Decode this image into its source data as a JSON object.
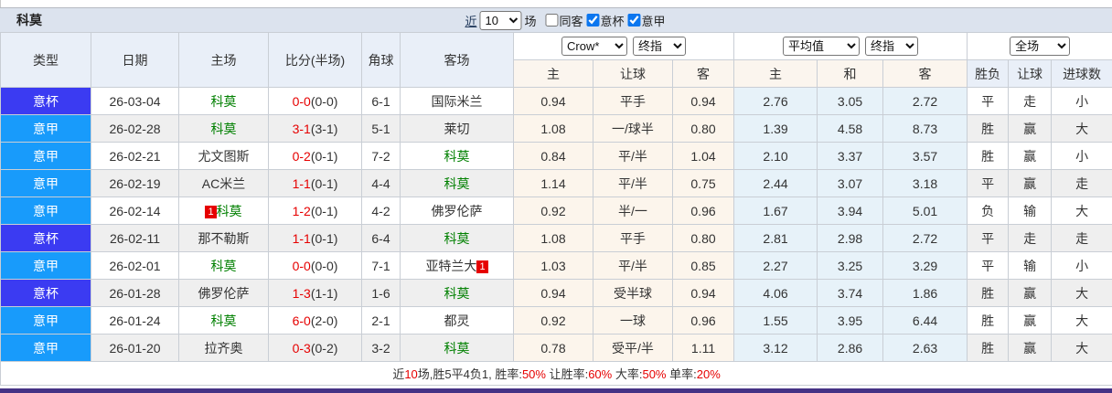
{
  "window": {
    "title": "科莫"
  },
  "toolbar": {
    "near_link": "近",
    "matches_count": "10",
    "matches_unit": "场",
    "filters": [
      {
        "label": "同客",
        "checked": false
      },
      {
        "label": "意杯",
        "checked": true
      },
      {
        "label": "意甲",
        "checked": true
      }
    ]
  },
  "table": {
    "columns": {
      "type": "类型",
      "date": "日期",
      "home": "主场",
      "score": "比分(半场)",
      "corner": "角球",
      "away": "客场"
    },
    "odds_group": {
      "bookmaker_select": "Crow*",
      "index_select": "终指",
      "subcols": [
        "主",
        "让球",
        "客"
      ]
    },
    "avg_group": {
      "avg_select": "平均值",
      "index_select": "终指",
      "subcols": [
        "主",
        "和",
        "客"
      ]
    },
    "result_group": {
      "scope_select": "全场",
      "subcols": [
        "胜负",
        "让球",
        "进球数"
      ]
    }
  },
  "rows": [
    {
      "type": "意杯",
      "type_class": "cup",
      "date": "26-03-04",
      "home": {
        "name": "科莫",
        "green": true
      },
      "score_ft": "0-0",
      "score_ht": "(0-0)",
      "corner": "6-1",
      "away": {
        "name": "国际米兰",
        "green": false
      },
      "odds": [
        "0.94",
        "平手",
        "0.94"
      ],
      "avg": [
        "2.76",
        "3.05",
        "2.72"
      ],
      "results": [
        {
          "t": "平",
          "c": "green"
        },
        {
          "t": "走",
          "c": "green"
        },
        {
          "t": "小",
          "c": "blue"
        }
      ]
    },
    {
      "type": "意甲",
      "type_class": "jia",
      "date": "26-02-28",
      "home": {
        "name": "科莫",
        "green": true
      },
      "score_ft": "3-1",
      "score_ht": "(3-1)",
      "corner": "5-1",
      "away": {
        "name": "莱切",
        "green": false
      },
      "odds": [
        "1.08",
        "一/球半",
        "0.80"
      ],
      "avg": [
        "1.39",
        "4.58",
        "8.73"
      ],
      "results": [
        {
          "t": "胜",
          "c": "red"
        },
        {
          "t": "赢",
          "c": "red"
        },
        {
          "t": "大",
          "c": "red"
        }
      ]
    },
    {
      "type": "意甲",
      "type_class": "jia",
      "date": "26-02-21",
      "home": {
        "name": "尤文图斯",
        "green": false
      },
      "score_ft": "0-2",
      "score_ht": "(0-1)",
      "corner": "7-2",
      "away": {
        "name": "科莫",
        "green": true
      },
      "odds": [
        "0.84",
        "平/半",
        "1.04"
      ],
      "avg": [
        "2.10",
        "3.37",
        "3.57"
      ],
      "results": [
        {
          "t": "胜",
          "c": "red"
        },
        {
          "t": "赢",
          "c": "red"
        },
        {
          "t": "小",
          "c": "blue"
        }
      ]
    },
    {
      "type": "意甲",
      "type_class": "jia",
      "date": "26-02-19",
      "home": {
        "name": "AC米兰",
        "green": false
      },
      "score_ft": "1-1",
      "score_ht": "(0-1)",
      "corner": "4-4",
      "away": {
        "name": "科莫",
        "green": true
      },
      "odds": [
        "1.14",
        "平/半",
        "0.75"
      ],
      "avg": [
        "2.44",
        "3.07",
        "3.18"
      ],
      "results": [
        {
          "t": "平",
          "c": "green"
        },
        {
          "t": "赢",
          "c": "red"
        },
        {
          "t": "走",
          "c": "green"
        }
      ]
    },
    {
      "type": "意甲",
      "type_class": "jia",
      "date": "26-02-14",
      "home": {
        "name": "科莫",
        "green": true,
        "badge_before": "1"
      },
      "score_ft": "1-2",
      "score_ht": "(0-1)",
      "corner": "4-2",
      "away": {
        "name": "佛罗伦萨",
        "green": false
      },
      "odds": [
        "0.92",
        "半/一",
        "0.96"
      ],
      "avg": [
        "1.67",
        "3.94",
        "5.01"
      ],
      "results": [
        {
          "t": "负",
          "c": "blue"
        },
        {
          "t": "输",
          "c": "blue"
        },
        {
          "t": "大",
          "c": "red"
        }
      ]
    },
    {
      "type": "意杯",
      "type_class": "cup",
      "date": "26-02-11",
      "home": {
        "name": "那不勒斯",
        "green": false
      },
      "score_ft": "1-1",
      "score_ht": "(0-1)",
      "corner": "6-4",
      "away": {
        "name": "科莫",
        "green": true
      },
      "odds": [
        "1.08",
        "平手",
        "0.80"
      ],
      "avg": [
        "2.81",
        "2.98",
        "2.72"
      ],
      "results": [
        {
          "t": "平",
          "c": "green"
        },
        {
          "t": "走",
          "c": "green"
        },
        {
          "t": "走",
          "c": "green"
        }
      ]
    },
    {
      "type": "意甲",
      "type_class": "jia",
      "date": "26-02-01",
      "home": {
        "name": "科莫",
        "green": true
      },
      "score_ft": "0-0",
      "score_ht": "(0-0)",
      "corner": "7-1",
      "away": {
        "name": "亚特兰大",
        "green": false,
        "badge_after": "1"
      },
      "odds": [
        "1.03",
        "平/半",
        "0.85"
      ],
      "avg": [
        "2.27",
        "3.25",
        "3.29"
      ],
      "results": [
        {
          "t": "平",
          "c": "green"
        },
        {
          "t": "输",
          "c": "blue"
        },
        {
          "t": "小",
          "c": "blue"
        }
      ]
    },
    {
      "type": "意杯",
      "type_class": "cup",
      "date": "26-01-28",
      "home": {
        "name": "佛罗伦萨",
        "green": false
      },
      "score_ft": "1-3",
      "score_ht": "(1-1)",
      "corner": "1-6",
      "away": {
        "name": "科莫",
        "green": true
      },
      "odds": [
        "0.94",
        "受半球",
        "0.94"
      ],
      "avg": [
        "4.06",
        "3.74",
        "1.86"
      ],
      "results": [
        {
          "t": "胜",
          "c": "red"
        },
        {
          "t": "赢",
          "c": "red"
        },
        {
          "t": "大",
          "c": "red"
        }
      ]
    },
    {
      "type": "意甲",
      "type_class": "jia",
      "date": "26-01-24",
      "home": {
        "name": "科莫",
        "green": true
      },
      "score_ft": "6-0",
      "score_ht": "(2-0)",
      "corner": "2-1",
      "away": {
        "name": "都灵",
        "green": false
      },
      "odds": [
        "0.92",
        "一球",
        "0.96"
      ],
      "avg": [
        "1.55",
        "3.95",
        "6.44"
      ],
      "results": [
        {
          "t": "胜",
          "c": "red"
        },
        {
          "t": "赢",
          "c": "red"
        },
        {
          "t": "大",
          "c": "red"
        }
      ]
    },
    {
      "type": "意甲",
      "type_class": "jia",
      "date": "26-01-20",
      "home": {
        "name": "拉齐奥",
        "green": false
      },
      "score_ft": "0-3",
      "score_ht": "(0-2)",
      "corner": "3-2",
      "away": {
        "name": "科莫",
        "green": true
      },
      "odds": [
        "0.78",
        "受平/半",
        "1.11"
      ],
      "avg": [
        "3.12",
        "2.86",
        "2.63"
      ],
      "results": [
        {
          "t": "胜",
          "c": "red"
        },
        {
          "t": "赢",
          "c": "red"
        },
        {
          "t": "大",
          "c": "red"
        }
      ]
    }
  ],
  "summary": {
    "segments": [
      {
        "text": "近",
        "red": false
      },
      {
        "text": "10",
        "red": true
      },
      {
        "text": "场,胜5平4负1, 胜率:",
        "red": false
      },
      {
        "text": "50%",
        "red": true
      },
      {
        "text": " 让胜率:",
        "red": false
      },
      {
        "text": "60%",
        "red": true
      },
      {
        "text": " 大率:",
        "red": false
      },
      {
        "text": "50%",
        "red": true
      },
      {
        "text": " 单率:",
        "red": false
      },
      {
        "text": "20%",
        "red": true
      }
    ]
  },
  "colors": {
    "jia": "#189bfb",
    "cup": "#3b3bf2",
    "red": "#e60000",
    "green": "#008000",
    "blue": "#1414dd",
    "cream": "#fcf5ec",
    "lblue": "#e7f2f9",
    "headerbg": "#e9eff8",
    "titlebar": "#dce3ee",
    "purple": "#453285"
  }
}
